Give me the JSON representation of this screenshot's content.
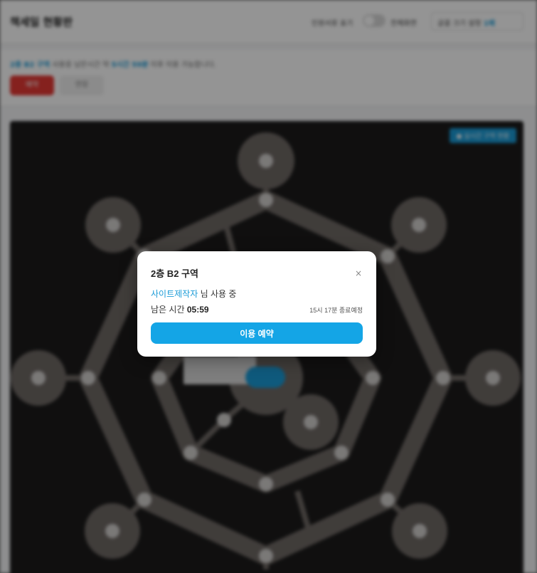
{
  "header": {
    "title": "책세일 현황판",
    "toggle_label": "인원서류 표기",
    "fullscreen_label": "전체화면",
    "select_label": "글꼴 크기 설정",
    "select_value": "1배"
  },
  "info": {
    "zone_label": "2층 B2 구역",
    "usage_text": "사용중",
    "remaining_prefix": "남은시간 약",
    "remaining_value": "5시간 59분",
    "remaining_suffix": "이후 이용 가능합니다.",
    "primary_button": "예약",
    "secondary_button": "연장"
  },
  "map": {
    "badge": "● 실시간 구역 현황"
  },
  "modal": {
    "title": "2층 B2 구역",
    "close_symbol": "×",
    "user_name": "사이트제작자",
    "user_suffix": "님 사용 중",
    "remaining_label": "남은 시간",
    "remaining_value": "05:59",
    "end_time": "15시 17분 종료예정",
    "reserve_button": "이용 예약"
  },
  "colors": {
    "accent": "#14a5e6",
    "danger": "#e53935",
    "map_bg": "#1c1b1b",
    "map_ring": "#6f6965"
  }
}
